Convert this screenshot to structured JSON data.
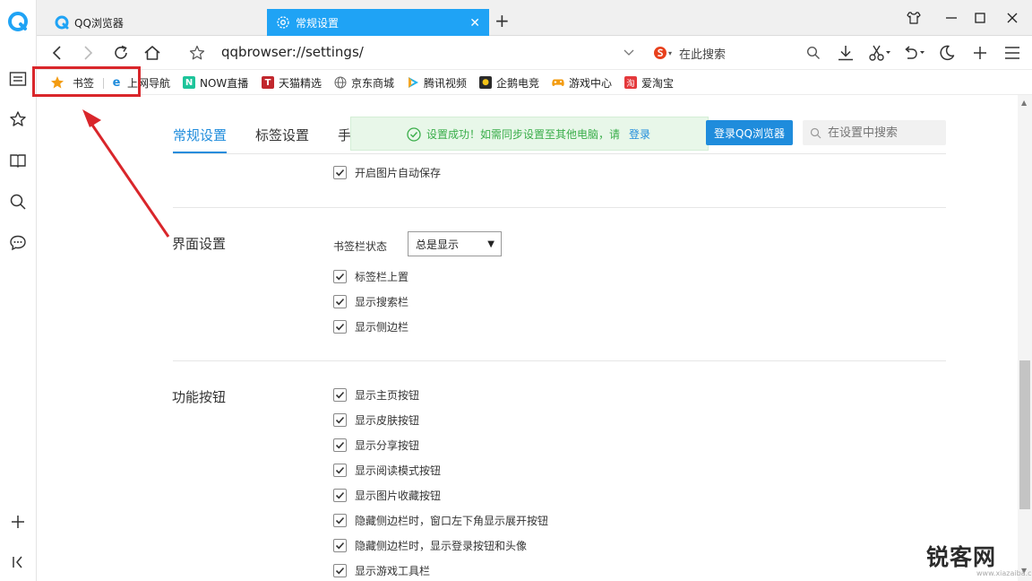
{
  "tabs": [
    {
      "label": "QQ浏览器",
      "active": false
    },
    {
      "label": "常规设置",
      "active": true
    }
  ],
  "toolbar": {
    "address": "qqbrowser://settings/",
    "search_placeholder": "在此搜索"
  },
  "bookmarks": [
    {
      "label": "书签",
      "icon": "star-icon"
    },
    {
      "label": "上网导航",
      "icon": "ie-icon"
    },
    {
      "label": "NOW直播",
      "icon": "now-icon"
    },
    {
      "label": "天猫精选",
      "icon": "tmall-icon"
    },
    {
      "label": "京东商城",
      "icon": "globe-icon"
    },
    {
      "label": "腾讯视频",
      "icon": "play-icon"
    },
    {
      "label": "企鹅电竞",
      "icon": "penguin-icon"
    },
    {
      "label": "游戏中心",
      "icon": "gamepad-icon"
    },
    {
      "label": "爱淘宝",
      "icon": "taobao-icon"
    }
  ],
  "settings": {
    "tabs": [
      "常规设置",
      "标签设置",
      "手"
    ],
    "toast": {
      "text": "设置成功！如需同步设置至其他电脑，请",
      "link": "登录"
    },
    "login_button": "登录QQ浏览器",
    "search_placeholder": "在设置中搜索",
    "top_checkbox": {
      "label": "开启图片自动保存",
      "checked": true
    },
    "sections": [
      {
        "title": "界面设置",
        "field_label": "书签栏状态",
        "select_value": "总是显示",
        "checkboxes": [
          {
            "label": "标签栏上置",
            "checked": true
          },
          {
            "label": "显示搜索栏",
            "checked": true
          },
          {
            "label": "显示侧边栏",
            "checked": true
          }
        ]
      },
      {
        "title": "功能按钮",
        "checkboxes": [
          {
            "label": "显示主页按钮",
            "checked": true
          },
          {
            "label": "显示皮肤按钮",
            "checked": true
          },
          {
            "label": "显示分享按钮",
            "checked": true
          },
          {
            "label": "显示阅读模式按钮",
            "checked": true
          },
          {
            "label": "显示图片收藏按钮",
            "checked": true
          },
          {
            "label": "隐藏侧边栏时，窗口左下角显示展开按钮",
            "checked": true
          },
          {
            "label": "隐藏侧边栏时，显示登录按钮和头像",
            "checked": true
          },
          {
            "label": "显示游戏工具栏",
            "checked": true
          }
        ]
      }
    ]
  },
  "watermark": {
    "text": "锐客网",
    "url": "www.xiazaiba.com"
  },
  "colors": {
    "accent": "#1f8cdc",
    "tab_active": "#1fa3f5",
    "highlight": "#d9262b",
    "toast_green": "#3aae4a"
  }
}
